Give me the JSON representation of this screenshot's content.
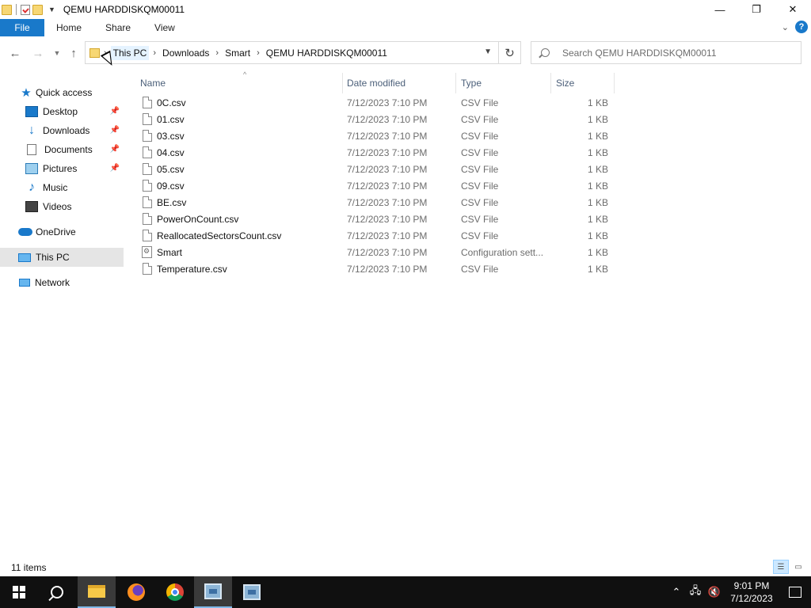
{
  "window": {
    "title": "QEMU HARDDISKQM00011",
    "controls": {
      "minimize": "—",
      "maximize": "❐",
      "close": "✕"
    }
  },
  "ribbon": {
    "tabs": [
      {
        "label": "File"
      },
      {
        "label": "Home"
      },
      {
        "label": "Share"
      },
      {
        "label": "View"
      }
    ],
    "help": "?"
  },
  "nav": {
    "breadcrumb": [
      "This PC",
      "Downloads",
      "Smart",
      "QEMU HARDDISKQM00011"
    ],
    "search_placeholder": "Search QEMU HARDDISKQM00011"
  },
  "sidebar": {
    "items": [
      {
        "label": "Quick access",
        "icon": "star-icon"
      },
      {
        "label": "Desktop",
        "icon": "desktop-icon",
        "pinned": true
      },
      {
        "label": "Downloads",
        "icon": "download-icon",
        "pinned": true
      },
      {
        "label": "Documents",
        "icon": "documents-icon",
        "pinned": true
      },
      {
        "label": "Pictures",
        "icon": "pictures-icon",
        "pinned": true
      },
      {
        "label": "Music",
        "icon": "music-icon"
      },
      {
        "label": "Videos",
        "icon": "videos-icon"
      },
      {
        "label": "OneDrive",
        "icon": "onedrive-icon"
      },
      {
        "label": "This PC",
        "icon": "this-pc-icon",
        "selected": true
      },
      {
        "label": "Network",
        "icon": "network-icon"
      }
    ]
  },
  "columns": {
    "name": "Name",
    "date": "Date modified",
    "type": "Type",
    "size": "Size"
  },
  "files": [
    {
      "name": "0C.csv",
      "date": "7/12/2023 7:10 PM",
      "type": "CSV File",
      "size": "1 KB",
      "icon": "file-icon"
    },
    {
      "name": "01.csv",
      "date": "7/12/2023 7:10 PM",
      "type": "CSV File",
      "size": "1 KB",
      "icon": "file-icon"
    },
    {
      "name": "03.csv",
      "date": "7/12/2023 7:10 PM",
      "type": "CSV File",
      "size": "1 KB",
      "icon": "file-icon"
    },
    {
      "name": "04.csv",
      "date": "7/12/2023 7:10 PM",
      "type": "CSV File",
      "size": "1 KB",
      "icon": "file-icon"
    },
    {
      "name": "05.csv",
      "date": "7/12/2023 7:10 PM",
      "type": "CSV File",
      "size": "1 KB",
      "icon": "file-icon"
    },
    {
      "name": "09.csv",
      "date": "7/12/2023 7:10 PM",
      "type": "CSV File",
      "size": "1 KB",
      "icon": "file-icon"
    },
    {
      "name": "BE.csv",
      "date": "7/12/2023 7:10 PM",
      "type": "CSV File",
      "size": "1 KB",
      "icon": "file-icon"
    },
    {
      "name": "PowerOnCount.csv",
      "date": "7/12/2023 7:10 PM",
      "type": "CSV File",
      "size": "1 KB",
      "icon": "file-icon"
    },
    {
      "name": "ReallocatedSectorsCount.csv",
      "date": "7/12/2023 7:10 PM",
      "type": "CSV File",
      "size": "1 KB",
      "icon": "file-icon"
    },
    {
      "name": "Smart",
      "date": "7/12/2023 7:10 PM",
      "type": "Configuration sett...",
      "size": "1 KB",
      "icon": "config-file-icon"
    },
    {
      "name": "Temperature.csv",
      "date": "7/12/2023 7:10 PM",
      "type": "CSV File",
      "size": "1 KB",
      "icon": "file-icon"
    }
  ],
  "status": {
    "count": "11 items"
  },
  "taskbar": {
    "apps": [
      "start-icon",
      "search-icon",
      "file-explorer-icon",
      "firefox-icon",
      "chrome-icon",
      "tool-icon",
      "tool-icon"
    ],
    "time": "9:01 PM",
    "date": "7/12/2023"
  },
  "colors": {
    "accent": "#1979ca",
    "selected_bg": "#e5e5e5",
    "taskbar": "#101010"
  }
}
